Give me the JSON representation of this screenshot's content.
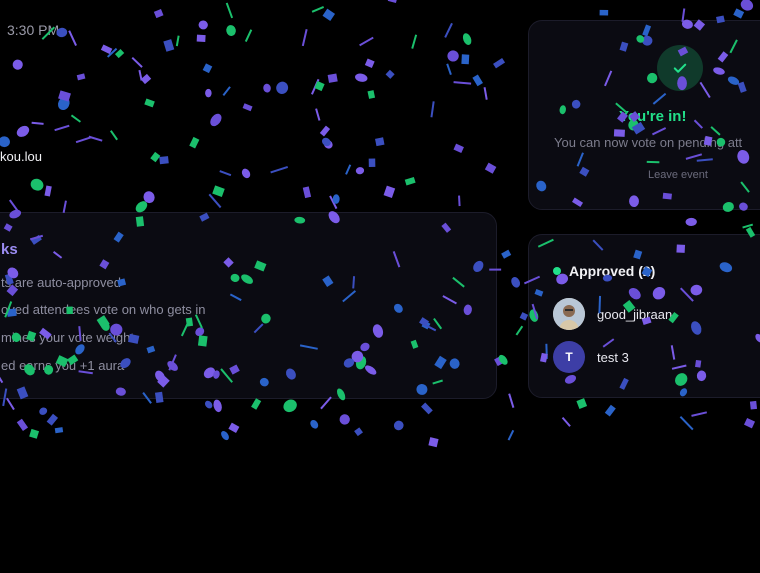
{
  "header": {
    "time": "3:30 PM",
    "handle": "kou.lou"
  },
  "how_it_works": {
    "title": "ks",
    "items": [
      "ts are auto-approved",
      "oved attendees vote on who gets in",
      "mines your vote weight.",
      "ed earns you +1 aura"
    ]
  },
  "status": {
    "title": "You're in!",
    "message": "You can now vote on pending att",
    "leave_label": "Leave event"
  },
  "approved": {
    "title": "Approved (2)",
    "users": [
      {
        "name": "good_jibraan",
        "avatar": ""
      },
      {
        "name": "test 3",
        "avatar": "T"
      }
    ]
  },
  "colors": {
    "accent_green": "#22e08a",
    "accent_purple": "#9b8cf2",
    "confetti": [
      "#6a4fd8",
      "#2a63c9",
      "#1bc06c",
      "#3b4fc0",
      "#7b5ce8"
    ]
  }
}
